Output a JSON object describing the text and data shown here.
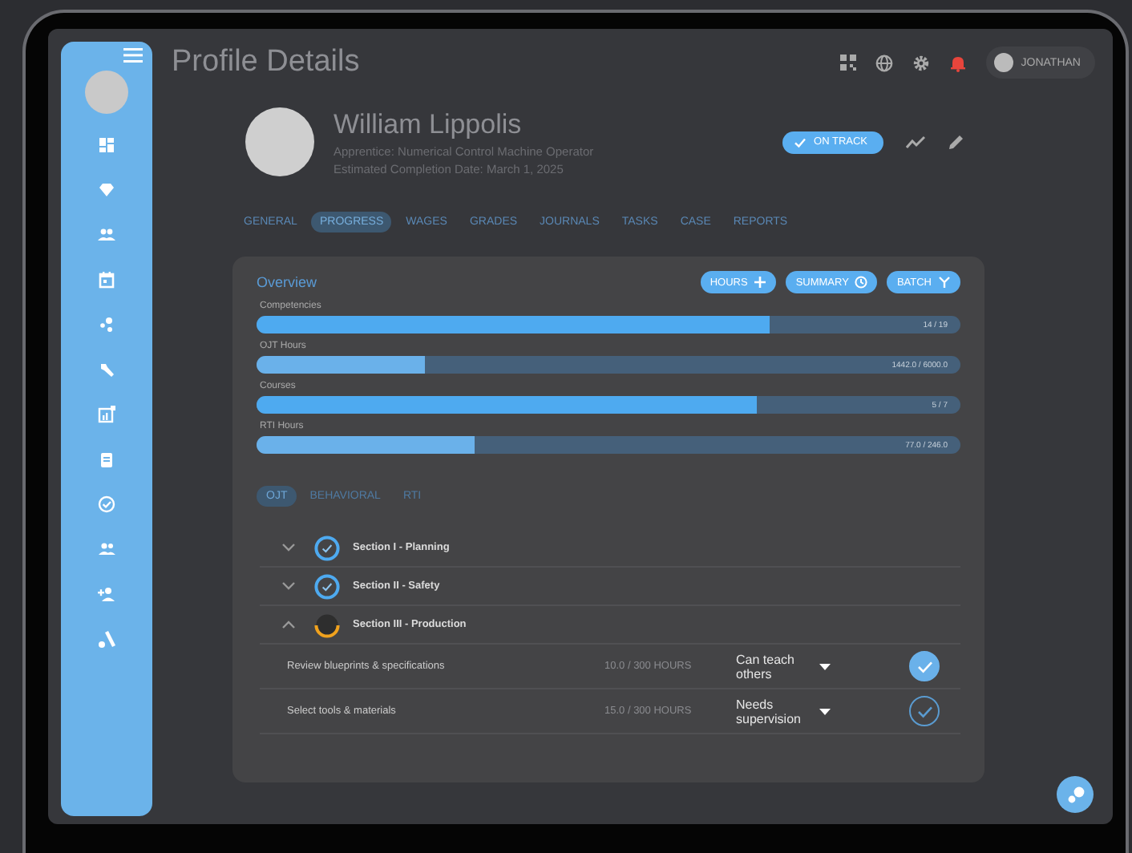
{
  "header": {
    "title": "Profile Details",
    "user": "JONATHAN",
    "alert": true
  },
  "profile": {
    "name": "William Lippolis",
    "role": "Apprentice: Numerical Control Machine Operator",
    "completion": "Estimated Completion Date: March 1, 2025",
    "status": "ON TRACK"
  },
  "tabs": [
    {
      "label": "GENERAL",
      "selected": false
    },
    {
      "label": "PROGRESS",
      "selected": true
    },
    {
      "label": "WAGES",
      "selected": false
    },
    {
      "label": "GRADES",
      "selected": false
    },
    {
      "label": "JOURNALS",
      "selected": false
    },
    {
      "label": "TASKS",
      "selected": false
    },
    {
      "label": "CASE",
      "selected": false
    },
    {
      "label": "REPORTS",
      "selected": false
    }
  ],
  "overview": {
    "title": "Overview",
    "buttons": [
      {
        "label": "HOURS",
        "kind": "plus"
      },
      {
        "label": "SUMMARY",
        "kind": "clock"
      },
      {
        "label": "BATCH",
        "kind": "merge"
      }
    ],
    "meters": [
      {
        "label": "Competencies",
        "reading": "14 / 19",
        "level": 0.73,
        "color": "#4eaaf0"
      },
      {
        "label": "OJT Hours",
        "reading": "1442.0 / 6000.0",
        "level": 0.24,
        "color": "#6ab1ea"
      },
      {
        "label": "Courses",
        "reading": "5 / 7",
        "level": 0.71,
        "color": "#4eaaf0"
      },
      {
        "label": "RTI Hours",
        "reading": "77.0 / 246.0",
        "level": 0.31,
        "color": "#6ab1ea"
      }
    ]
  },
  "subtabs": [
    {
      "label": "OJT",
      "selected": true
    },
    {
      "label": "BEHAVIORAL",
      "selected": false
    },
    {
      "label": "RTI",
      "selected": false
    }
  ],
  "sections": [
    {
      "title": "Section I - Planning",
      "expanded": false,
      "kind": "complete"
    },
    {
      "title": "Section II - Safety",
      "expanded": false,
      "kind": "complete"
    },
    {
      "title": "Section III - Production",
      "expanded": true,
      "kind": "partial"
    }
  ],
  "tasks": [
    {
      "name": "Review blueprints & specifications",
      "hours": "10.0 / 300 HOURS",
      "rating": "Can teach others",
      "kind": "approved"
    },
    {
      "name": "Select tools & materials",
      "hours": "15.0 / 300 HOURS",
      "rating": "Needs supervision",
      "kind": "pending"
    }
  ]
}
